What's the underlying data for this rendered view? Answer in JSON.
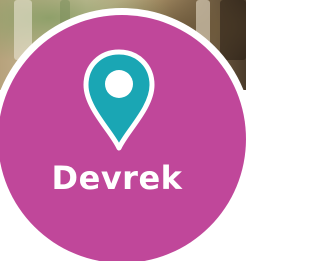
{
  "location_badge": {
    "place_name": "Devrek",
    "icon": "map-pin-icon",
    "colors": {
      "badge": "#c0479a",
      "pin": "#1aa6b4",
      "pin_outline": "#ffffff",
      "text": "#ffffff"
    }
  }
}
